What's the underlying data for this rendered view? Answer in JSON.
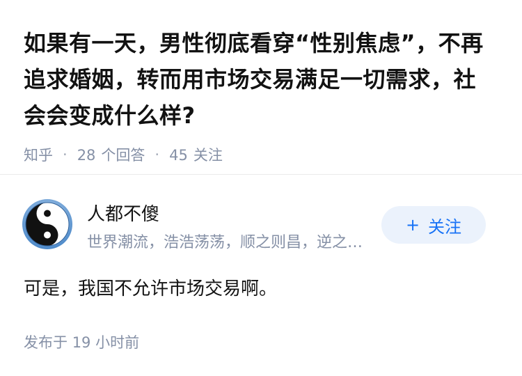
{
  "question": {
    "title": "如果有一天，男性彻底看穿“性别焦虑”，不再追求婚姻，转而用市场交易满足一切需求，社会会变成什么样?",
    "source": "知乎",
    "answer_count": "28",
    "answer_count_label": "个回答",
    "follower_count": "45",
    "follower_count_label": "关注"
  },
  "answer": {
    "author": {
      "name": "人都不傻",
      "bio": "世界潮流，浩浩荡荡，顺之则昌，逆之则亡",
      "avatar_icon": "yin-yang-icon"
    },
    "follow_button": {
      "icon": "+",
      "label": "关注"
    },
    "content": "可是，我国不允许市场交易啊。",
    "publish_prefix": "发布于",
    "publish_time": "19 小时前"
  },
  "colors": {
    "text_primary": "#121212",
    "text_secondary": "#8590a6",
    "accent": "#1772f6",
    "button_bg": "#ebf2fc"
  }
}
